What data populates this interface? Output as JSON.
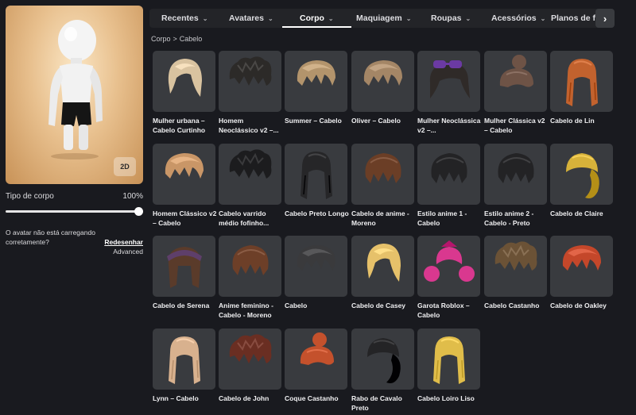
{
  "tabs": [
    {
      "label": "Recentes",
      "chevron": true,
      "active": false
    },
    {
      "label": "Avatares",
      "chevron": true,
      "active": false
    },
    {
      "label": "Corpo",
      "chevron": true,
      "active": true
    },
    {
      "label": "Maquiagem",
      "chevron": true,
      "active": false
    },
    {
      "label": "Roupas",
      "chevron": true,
      "active": false
    },
    {
      "label": "Acessórios",
      "chevron": true,
      "active": false
    },
    {
      "label": "Planos de fu",
      "chevron": false,
      "active": false
    }
  ],
  "breadcrumb": {
    "parent": "Corpo",
    "separator": ">",
    "current": "Cabelo"
  },
  "avatar_preview": {
    "view_button": "2D"
  },
  "body_type": {
    "label": "Tipo de corpo",
    "value_text": "100%",
    "value": 1.0
  },
  "loading_notice": {
    "message": "O avatar não está carregando corretamente?",
    "redraw": "Redesenhar",
    "advanced": "Advanced"
  },
  "items": [
    {
      "name": "Mulher urbana – Cabelo Curtinho",
      "color": "#d9c3a0",
      "style": "bob"
    },
    {
      "name": "Homem Neoclássico v2 –...",
      "color": "#2c2a28",
      "style": "messy"
    },
    {
      "name": "Summer – Cabelo",
      "color": "#b3946c",
      "style": "swept"
    },
    {
      "name": "Oliver – Cabelo",
      "color": "#a48666",
      "style": "swept"
    },
    {
      "name": "Mulher Neoclássica v2 –...",
      "color": "#2f2a28",
      "style": "glasses"
    },
    {
      "name": "Mulher Clássica v2 – Cabelo",
      "color": "#6e5346",
      "style": "bun"
    },
    {
      "name": "Cabelo de Lin",
      "color": "#c2622e",
      "style": "long"
    },
    {
      "name": "Homem Clássico v2 – Cabelo",
      "color": "#c99667",
      "style": "swept"
    },
    {
      "name": "Cabelo varrido médio fofinho...",
      "color": "#1c1c1e",
      "style": "messy"
    },
    {
      "name": "Cabelo Preto Longo",
      "color": "#262628",
      "style": "long"
    },
    {
      "name": "Cabelo de anime - Moreno",
      "color": "#6b3e26",
      "style": "anime"
    },
    {
      "name": "Estilo anime 1 - Cabelo",
      "color": "#232325",
      "style": "anime"
    },
    {
      "name": "Estilo anime 2 - Cabelo - Preto",
      "color": "#232325",
      "style": "anime"
    },
    {
      "name": "Cabelo de Claire",
      "color": "#d7b23a",
      "style": "ponytail"
    },
    {
      "name": "Cabelo de Serena",
      "color": "#5a3b2a",
      "style": "headband"
    },
    {
      "name": "Anime feminino - Cabelo - Moreno",
      "color": "#6d3f28",
      "style": "anime"
    },
    {
      "name": "Cabelo",
      "color": "#3a3a3c",
      "style": "swept"
    },
    {
      "name": "Cabelo de Casey",
      "color": "#e6c16a",
      "style": "bob"
    },
    {
      "name": "Garota Roblox – Cabelo",
      "color": "#d9388f",
      "style": "pigtails"
    },
    {
      "name": "Cabelo Castanho",
      "color": "#6b5236",
      "style": "messy"
    },
    {
      "name": "Cabelo de Oakley",
      "color": "#c4472a",
      "style": "swept"
    },
    {
      "name": "Lynn – Cabelo",
      "color": "#d8b18e",
      "style": "long"
    },
    {
      "name": "Cabelo de John",
      "color": "#6a2e22",
      "style": "messy"
    },
    {
      "name": "Coque Castanho",
      "color": "#c4512c",
      "style": "bun"
    },
    {
      "name": "Rabo de Cavalo Preto",
      "color": "#242426",
      "style": "ponytail"
    },
    {
      "name": "Cabelo Loiro Liso",
      "color": "#e0bd4a",
      "style": "long"
    }
  ]
}
